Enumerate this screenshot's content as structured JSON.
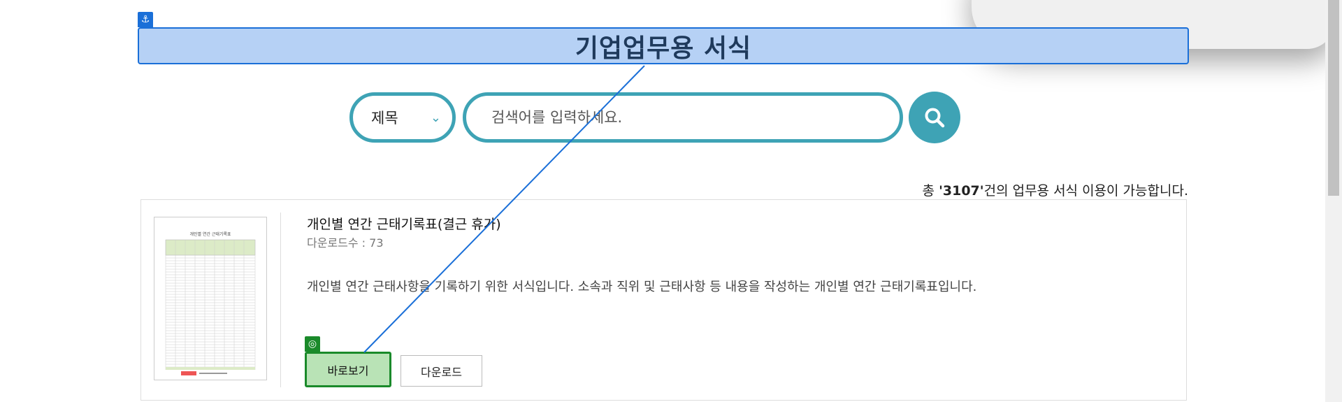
{
  "header": {
    "title": "기업업무용 서식",
    "anchor_icon": "anchor-icon"
  },
  "search": {
    "select_value": "제목",
    "placeholder": "검색어를 입력하세요.",
    "accent_color": "#3ea3b5"
  },
  "summary": {
    "prefix": "총 ",
    "count": "'3107'",
    "suffix": "건의 업무용 서식 이용이 가능합니다."
  },
  "result": {
    "title": "개인별 연간 근태기록표(결근 휴가)",
    "download_count": "다운로드수 : 73",
    "description": "개인별 연간 근태사항을 기록하기 위한 서식입니다. 소속과 직위 및 근태사항 등 내용을 작성하는 개인별 연간 근태기록표입니다.",
    "thumbnail_title": "개인별 연간 근태기록표",
    "view_label": "바로보기",
    "download_label": "다운로드"
  },
  "colors": {
    "highlight_blue": "#1a6fd8",
    "highlight_green": "#1a8a2a"
  }
}
